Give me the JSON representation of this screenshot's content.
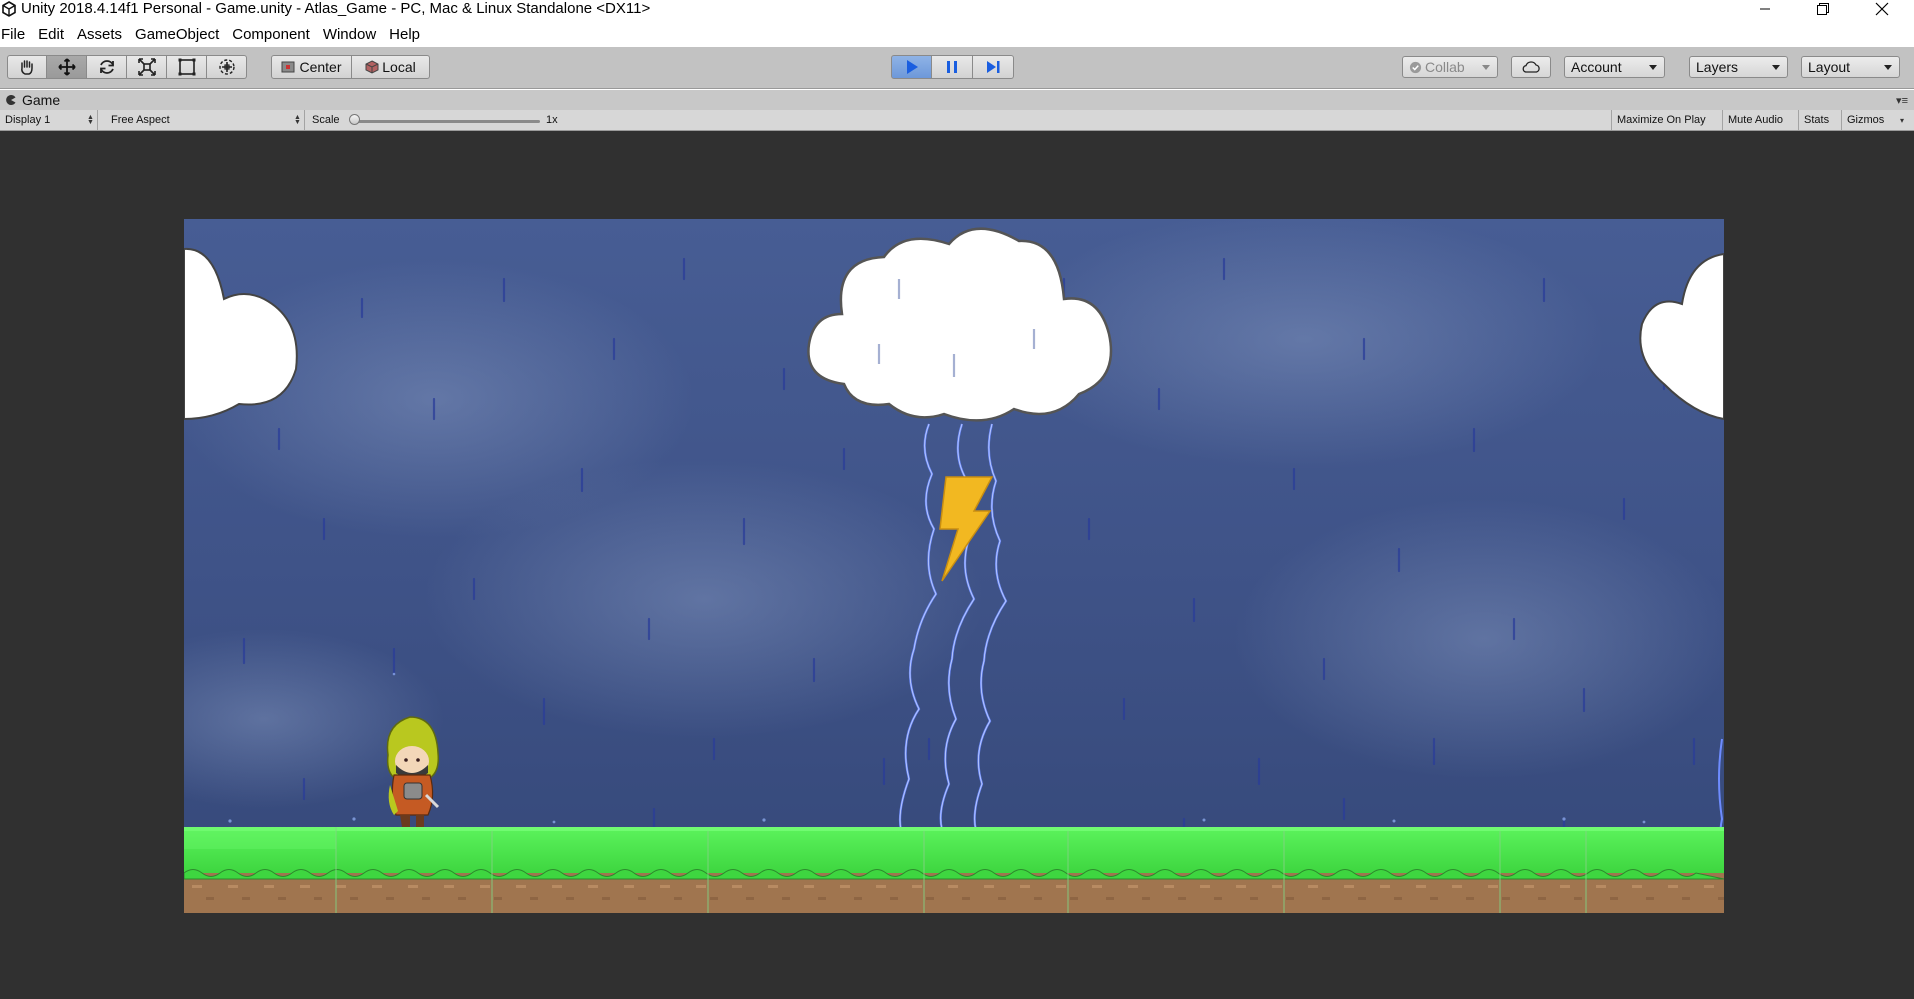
{
  "window": {
    "title": "Unity 2018.4.14f1 Personal - Game.unity - Atlas_Game - PC, Mac & Linux Standalone <DX11>"
  },
  "menu": [
    "File",
    "Edit",
    "Assets",
    "GameObject",
    "Component",
    "Window",
    "Help"
  ],
  "toolbar": {
    "transform_tools": [
      "hand-icon",
      "move-icon",
      "rotate-icon",
      "scale-icon",
      "rect-icon",
      "transform-icon"
    ],
    "pivot_label": "Center",
    "space_label": "Local",
    "collab_label": "Collab",
    "account_label": "Account",
    "layers_label": "Layers",
    "layout_label": "Layout"
  },
  "game_tab": {
    "title": "Game",
    "display": "Display 1",
    "aspect": "Free Aspect",
    "scale_label": "Scale",
    "scale_value": "1x",
    "maximize_on_play": "Maximize On Play",
    "mute_audio": "Mute Audio",
    "stats": "Stats",
    "gizmos": "Gizmos"
  },
  "colors": {
    "toolbar_bg": "#c2c2c2",
    "play_active": "#6d98d9",
    "editor_dark": "#303030",
    "sky": "#3d5186",
    "grass": "#4bea4e",
    "dirt": "#a0754f",
    "bolt": "#f2b821"
  }
}
